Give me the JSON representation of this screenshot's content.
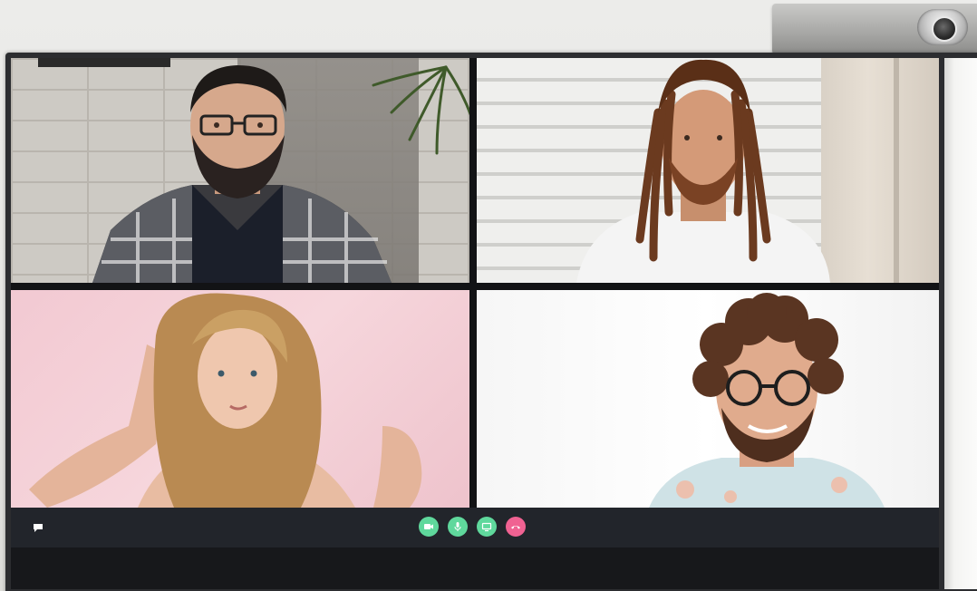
{
  "app": {
    "window_title": ""
  },
  "participants": [
    {
      "name": "",
      "tile": 1
    },
    {
      "name": "",
      "tile": 2
    },
    {
      "name": "",
      "tile": 3
    },
    {
      "name": "",
      "tile": 4
    }
  ],
  "controls": {
    "chat": {
      "icon": "chat-bubble-icon",
      "color": "#ffffff"
    },
    "camera": {
      "icon": "video-camera-icon",
      "color": "#5fd89c"
    },
    "microphone": {
      "icon": "microphone-icon",
      "color": "#5fd89c"
    },
    "screen_share": {
      "icon": "screen-share-icon",
      "color": "#5fd89c"
    },
    "end_call": {
      "icon": "phone-hangup-icon",
      "color": "#f06292"
    }
  },
  "colors": {
    "accent_green": "#5fd89c",
    "end_call_pink": "#f06292",
    "control_bar": "#22252b"
  }
}
